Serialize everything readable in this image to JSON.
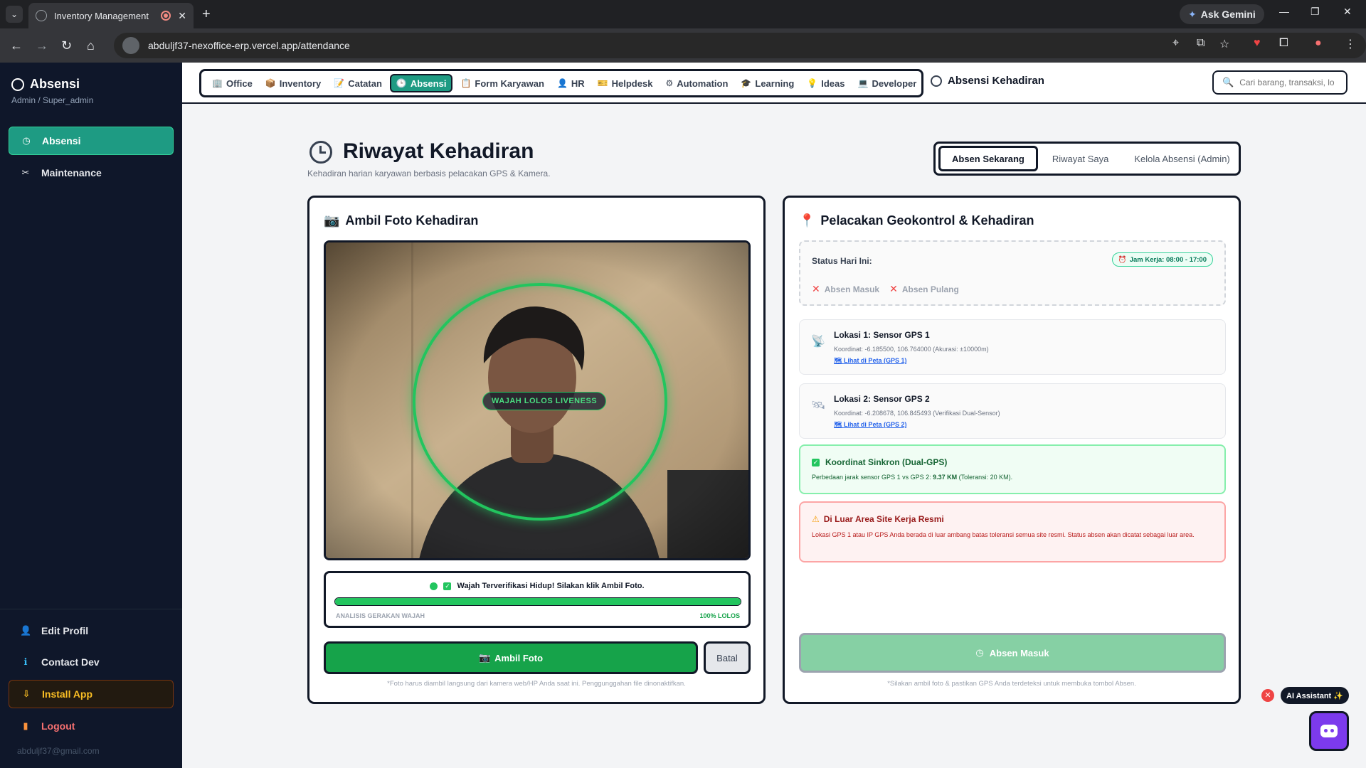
{
  "browser": {
    "tab_title": "Inventory Management",
    "new_tab": "+",
    "gemini_label": "Ask Gemini",
    "url": "abduljf37-nexoffice-erp.vercel.app/attendance"
  },
  "sidebar": {
    "brand": "Absensi",
    "role": "Admin / Super_admin",
    "items": [
      {
        "label": "Absensi",
        "icon": "clock-icon",
        "active": true
      },
      {
        "label": "Maintenance",
        "icon": "tools-icon",
        "active": false
      }
    ],
    "bottom": [
      {
        "label": "Edit Profil",
        "icon": "user-icon"
      },
      {
        "label": "Contact Dev",
        "icon": "info-icon"
      },
      {
        "label": "Install App",
        "icon": "download-icon"
      },
      {
        "label": "Logout",
        "icon": "logout-icon"
      }
    ],
    "email": "abduljf37@gmail.com"
  },
  "topnav": {
    "modules": [
      {
        "label": "Office",
        "emoji": "🏢"
      },
      {
        "label": "Inventory",
        "emoji": "📦"
      },
      {
        "label": "Catatan",
        "emoji": "📝"
      },
      {
        "label": "Absensi",
        "emoji": "🕒",
        "active": true
      },
      {
        "label": "Form Karyawan",
        "emoji": "📋"
      },
      {
        "label": "HR",
        "emoji": "👤"
      },
      {
        "label": "Helpdesk",
        "emoji": "🎫"
      },
      {
        "label": "Automation",
        "emoji": "⚙"
      },
      {
        "label": "Learning",
        "emoji": "🎓"
      },
      {
        "label": "Ideas",
        "emoji": "💡"
      },
      {
        "label": "Developer",
        "emoji": "💻"
      }
    ],
    "page_label": "Absensi Kehadiran",
    "search_placeholder": "Cari barang, transaksi, lo"
  },
  "header": {
    "title": "Riwayat Kehadiran",
    "subtitle": "Kehadiran harian karyawan berbasis pelacakan GPS & Kamera.",
    "tabs": [
      "Absen Sekarang",
      "Riwayat Saya",
      "Kelola Absensi (Admin)"
    ],
    "active_tab": "Absen Sekarang"
  },
  "photo_card": {
    "title": "Ambil Foto Kehadiran",
    "liveness_badge": "WAJAH LOLOS LIVENESS",
    "verify_message": "Wajah Terverifikasi Hidup! Silakan klik Ambil Foto.",
    "analysis_label": "ANALISIS GERAKAN WAJAH",
    "analysis_result": "100% LOLOS",
    "analysis_progress": 1.0,
    "capture_button": "Ambil Foto",
    "cancel_button": "Batal",
    "note": "*Foto harus diambil langsung dari kamera web/HP Anda saat ini. Penggunggahan file dinonaktifkan."
  },
  "geo_card": {
    "title": "Pelacakan Geokontrol & Kehadiran",
    "status_label": "Status Hari Ini:",
    "work_hours": "Jam Kerja: 08:00 - 17:00",
    "status_items": [
      "Absen Masuk",
      "Absen Pulang"
    ],
    "locations": [
      {
        "title": "Lokasi 1: Sensor GPS 1",
        "coord": "Koordinat: -6.185500, 106.764000 (Akurasi: ±10000m)",
        "link": "Lihat di Peta (GPS 1)"
      },
      {
        "title": "Lokasi 2: Sensor GPS 2",
        "coord": "Koordinat: -6.208678, 106.845493 (Verifikasi Dual-Sensor)",
        "link": "Lihat di Peta (GPS 2)"
      }
    ],
    "sync_title": "Koordinat Sinkron (Dual-GPS)",
    "sync_desc_prefix": "Perbedaan jarak sensor GPS 1 vs GPS 2:",
    "sync_distance": "9.37 KM",
    "sync_desc_suffix": "(Toleransi: 20 KM).",
    "warning_title": "Di Luar Area Site Kerja Resmi",
    "warning_desc": "Lokasi GPS 1 atau IP GPS Anda berada di luar ambang batas toleransi semua site resmi. Status absen akan dicatat sebagai luar area.",
    "checkin_button": "Absen Masuk",
    "note": "*Silakan ambil foto & pastikan GPS Anda terdeteksi untuk membuka tombol Absen."
  },
  "assistant": {
    "label": "AI Assistant ✨"
  },
  "colors": {
    "accent": "#1e9b83",
    "success": "#16a34a",
    "danger": "#ef4444",
    "sidebar_bg": "#0f172a"
  }
}
